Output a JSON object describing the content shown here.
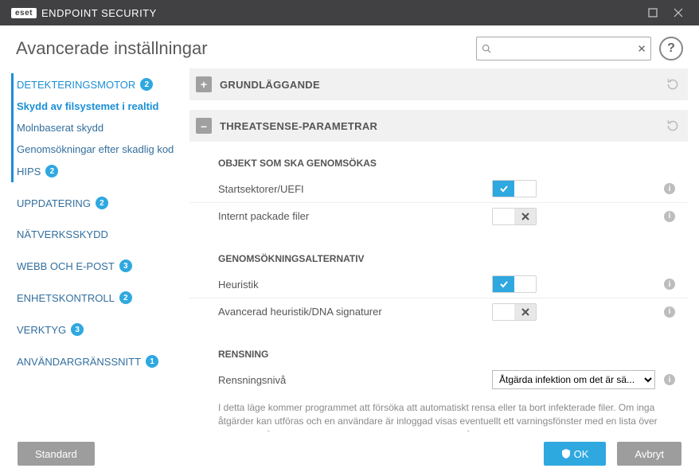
{
  "titlebar": {
    "brand_mark": "eset",
    "brand_text": "ENDPOINT SECURITY"
  },
  "header": {
    "title": "Avancerade inställningar",
    "search_placeholder": "",
    "help_label": "?"
  },
  "sidebar": {
    "items": [
      {
        "label": "Detekteringsmotor",
        "badge": "2"
      },
      {
        "label": "Skydd av filsystemet i realtid"
      },
      {
        "label": "Molnbaserat skydd"
      },
      {
        "label": "Genomsökningar efter skadlig kod"
      },
      {
        "label": "HIPS",
        "badge": "2"
      },
      {
        "label": "Uppdatering",
        "badge": "2"
      },
      {
        "label": "Nätverksskydd"
      },
      {
        "label": "Webb och e-post",
        "badge": "3"
      },
      {
        "label": "Enhetskontroll",
        "badge": "2"
      },
      {
        "label": "Verktyg",
        "badge": "3"
      },
      {
        "label": "Användargränssnitt",
        "badge": "1"
      }
    ]
  },
  "sections": {
    "basic": {
      "title": "Grundläggande"
    },
    "threatsense": {
      "title": "Threatsense-parametrar",
      "objects_title": "Objekt som ska genomsökas",
      "r_bootsectors": "Startsektorer/UEFI",
      "r_packed": "Internt packade filer",
      "scanopts_title": "Genomsökningsalternativ",
      "r_heur": "Heuristik",
      "r_advheur": "Avancerad heuristik/DNA signaturer",
      "cleaning_title": "Rensning",
      "r_level": "Rensningsnivå",
      "level_value": "Åtgärda infektion om det är sä...",
      "helptext": "I detta läge kommer programmet att försöka att automatiskt rensa eller ta bort infekterade filer. Om inga åtgärder kan utföras och en användare är inloggad visas eventuellt ett varningsfönster med en lista över tillgängliga åtgärder. Ett varningsfönster visas även om en åtgärd misslyckas."
    }
  },
  "footer": {
    "default": "Standard",
    "ok": "OK",
    "cancel": "Avbryt"
  }
}
